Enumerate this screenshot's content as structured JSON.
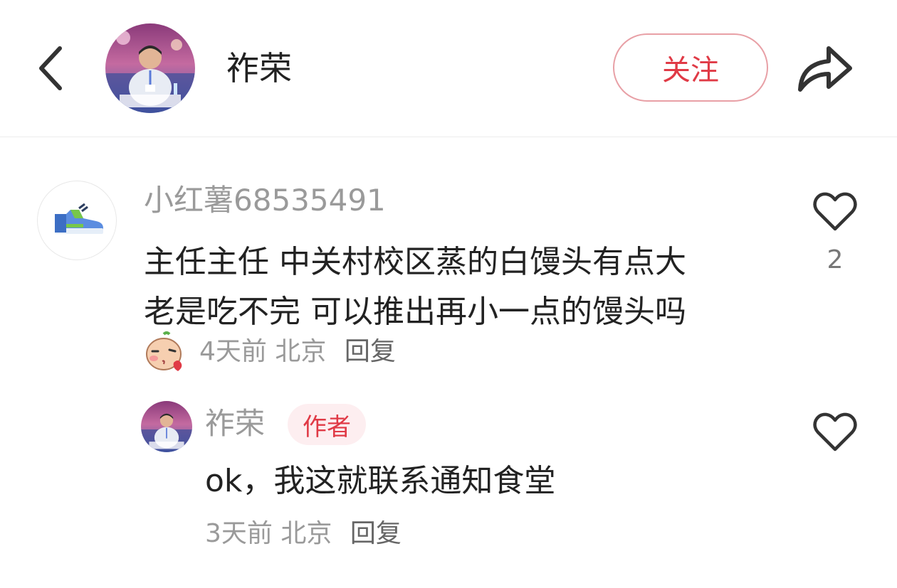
{
  "header": {
    "back_icon": "chevron-left-icon",
    "author_name": "祚荣",
    "follow_label": "关注",
    "share_icon": "share-arrow-icon"
  },
  "comment": {
    "username": "小红薯68535491",
    "text_lines": [
      "主任主任 中关村校区蒸的白馒头有点大",
      "老是吃不完 可以推出再小一点的馒头吗"
    ],
    "sticker_icon": "kiss-face-sticker-icon",
    "time": "4天前",
    "location": "北京",
    "reply_label": "回复",
    "like_count": "2"
  },
  "reply": {
    "username": "祚荣",
    "badge": "作者",
    "text": "ok，我这就联系通知食堂",
    "time": "3天前",
    "location": "北京",
    "reply_label": "回复"
  },
  "colors": {
    "accent": "#e03a46",
    "muted": "#9a9a9a",
    "badge_bg": "#fdeef0"
  }
}
